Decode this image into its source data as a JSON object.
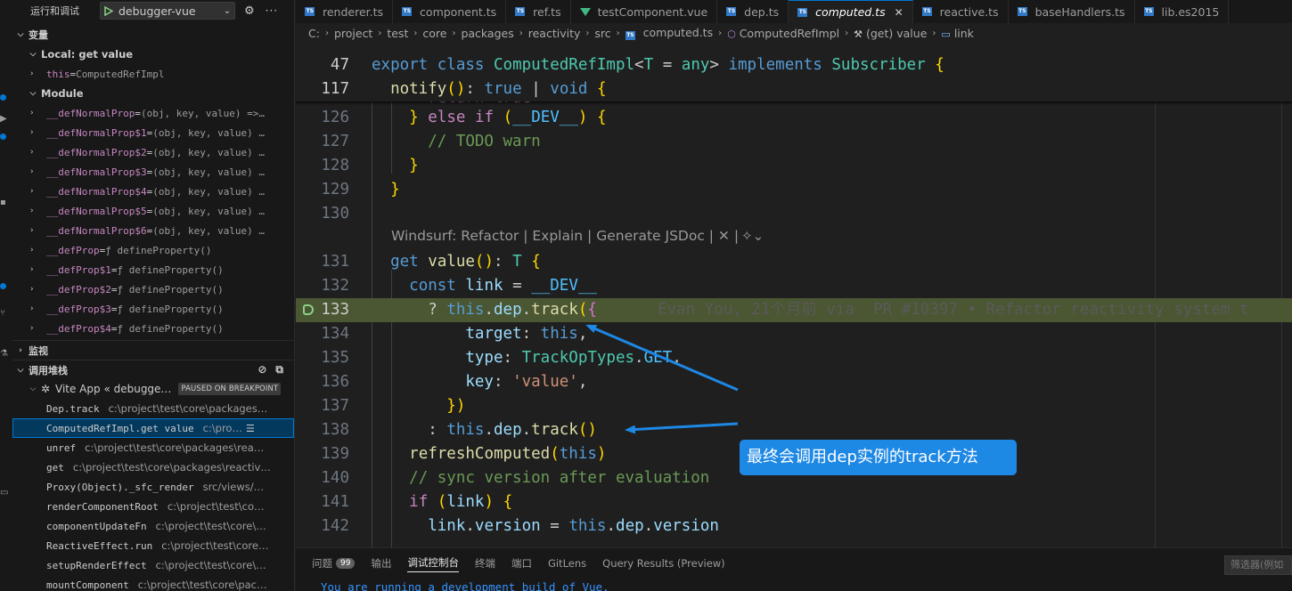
{
  "debug": {
    "title": "运行和调试",
    "config": "debugger-vue"
  },
  "variables": {
    "header": "变量",
    "local_scope": "Local: get value",
    "local_items": [
      {
        "name": "this",
        "value": "ComputedRefImpl"
      }
    ],
    "module_scope": "Module",
    "module_items": [
      {
        "name": "__defNormalProp",
        "value": "(obj, key, value) =>…"
      },
      {
        "name": "__defNormalProp$1",
        "value": "(obj, key, value) …"
      },
      {
        "name": "__defNormalProp$2",
        "value": "(obj, key, value) …"
      },
      {
        "name": "__defNormalProp$3",
        "value": "(obj, key, value) …"
      },
      {
        "name": "__defNormalProp$4",
        "value": "(obj, key, value) …"
      },
      {
        "name": "__defNormalProp$5",
        "value": "(obj, key, value) …"
      },
      {
        "name": "__defNormalProp$6",
        "value": "(obj, key, value) …"
      },
      {
        "name": "__defProp",
        "value": "ƒ defineProperty()"
      },
      {
        "name": "__defProp$1",
        "value": "ƒ defineProperty()"
      },
      {
        "name": "__defProp$2",
        "value": "ƒ defineProperty()"
      },
      {
        "name": "__defProp$3",
        "value": "ƒ defineProperty()"
      },
      {
        "name": "__defProp$4",
        "value": "ƒ defineProperty()"
      }
    ]
  },
  "watch": {
    "header": "监视"
  },
  "callstack": {
    "header": "调用堆栈",
    "session": "Vite App « debugge…",
    "paused_badge": "PAUSED ON BREAKPOINT",
    "frames": [
      {
        "name": "Dep.track",
        "path": "c:\\project\\test\\core\\packages…"
      },
      {
        "name": "ComputedRefImpl.get value",
        "path": "c:\\pro…",
        "selected": true
      },
      {
        "name": "unref",
        "path": "c:\\project\\test\\core\\packages\\rea…"
      },
      {
        "name": "get",
        "path": "c:\\project\\test\\core\\packages\\reactiv…"
      },
      {
        "name": "Proxy(Object)._sfc_render",
        "path": "src/views/…"
      },
      {
        "name": "renderComponentRoot",
        "path": "c:\\project\\test\\co…"
      },
      {
        "name": "componentUpdateFn",
        "path": "c:\\project\\test\\core\\…"
      },
      {
        "name": "ReactiveEffect.run",
        "path": "c:\\project\\test\\core…"
      },
      {
        "name": "setupRenderEffect",
        "path": "c:\\project\\test\\core\\…"
      },
      {
        "name": "mountComponent",
        "path": "c:\\project\\test\\core\\pac…"
      }
    ]
  },
  "tabs": [
    {
      "label": "renderer.ts",
      "icon": "ts"
    },
    {
      "label": "component.ts",
      "icon": "ts"
    },
    {
      "label": "ref.ts",
      "icon": "ts"
    },
    {
      "label": "testComponent.vue",
      "icon": "vue"
    },
    {
      "label": "dep.ts",
      "icon": "ts"
    },
    {
      "label": "computed.ts",
      "icon": "ts",
      "active": true
    },
    {
      "label": "reactive.ts",
      "icon": "ts"
    },
    {
      "label": "baseHandlers.ts",
      "icon": "ts"
    },
    {
      "label": "lib.es2015",
      "icon": "ts"
    }
  ],
  "breadcrumb": {
    "parts": [
      "C:",
      "project",
      "test",
      "core",
      "packages",
      "reactivity",
      "src"
    ],
    "file": "computed.ts",
    "class": "ComputedRefImpl",
    "getter": "(get) value",
    "field": "link"
  },
  "code": {
    "sticky": [
      {
        "ln": "47",
        "text": "export class ComputedRefImpl<T = any> implements Subscriber {"
      },
      {
        "ln": "117",
        "text": "  notify(): true | void {"
      }
    ],
    "partial_line": "      return true",
    "lines": [
      {
        "ln": "126",
        "text": "    } else if (__DEV__) {"
      },
      {
        "ln": "127",
        "text": "      // TODO warn"
      },
      {
        "ln": "128",
        "text": "    }"
      },
      {
        "ln": "129",
        "text": "  }"
      },
      {
        "ln": "130",
        "text": ""
      },
      {
        "ln": "131",
        "text": "  get value(): T {"
      },
      {
        "ln": "132",
        "text": "    const link = __DEV__"
      },
      {
        "ln": "133",
        "text": "      ? this.dep.track({"
      },
      {
        "ln": "134",
        "text": "          target: this,"
      },
      {
        "ln": "135",
        "text": "          type: TrackOpTypes.GET,"
      },
      {
        "ln": "136",
        "text": "          key: 'value',"
      },
      {
        "ln": "137",
        "text": "        })"
      },
      {
        "ln": "138",
        "text": "      : this.dep.track()"
      },
      {
        "ln": "139",
        "text": "    refreshComputed(this)"
      },
      {
        "ln": "140",
        "text": "    // sync version after evaluation"
      },
      {
        "ln": "141",
        "text": "    if (link) {"
      },
      {
        "ln": "142",
        "text": "      link.version = this.dep.version"
      }
    ],
    "codelens": "Windsurf: Refactor | Explain | Generate JSDoc | ✕ | ",
    "blame": "Evan You, 21个月前 via  PR #10397 • Refactor reactivity system t"
  },
  "annotation": {
    "text": "最终会调用dep实例的track方法"
  },
  "panel": {
    "tabs": [
      "问题",
      "输出",
      "调试控制台",
      "终端",
      "端口",
      "GitLens",
      "Query Results (Preview)"
    ],
    "problems_count": "99",
    "active_tab": "调试控制台",
    "filter_placeholder": "筛选器(例如",
    "console_text": "You are running a development build of Vue."
  }
}
